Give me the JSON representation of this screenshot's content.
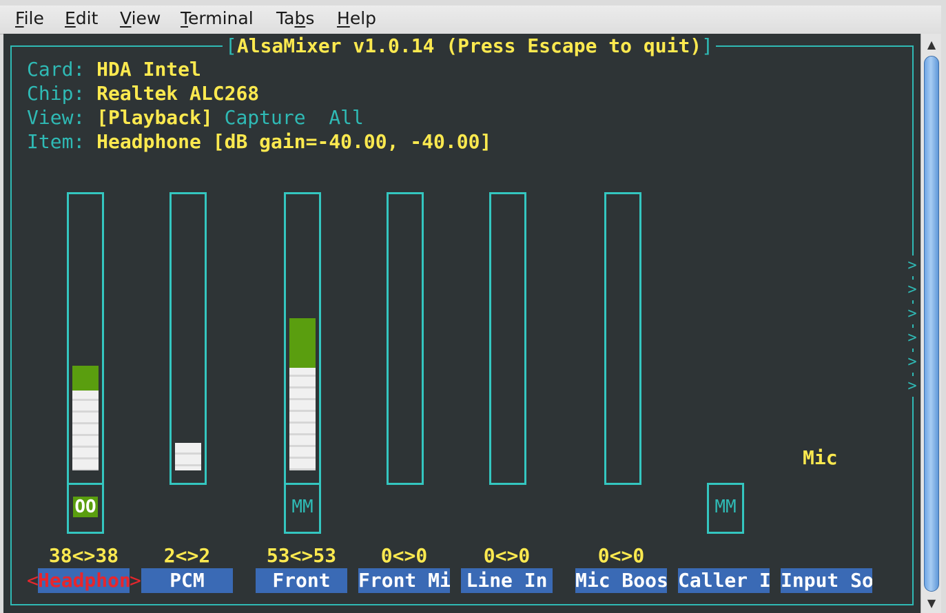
{
  "menu": [
    {
      "mnemonic": "F",
      "rest": "ile"
    },
    {
      "mnemonic": "E",
      "rest": "dit"
    },
    {
      "mnemonic": "V",
      "rest": "iew"
    },
    {
      "mnemonic": "T",
      "rest": "erminal"
    },
    {
      "pre": "Ta",
      "mnemonic": "b",
      "rest": "s"
    },
    {
      "mnemonic": "H",
      "rest": "elp"
    }
  ],
  "title": {
    "open": "[",
    "text": "AlsaMixer v1.0.14 (Press Escape to quit)",
    "close": "]"
  },
  "info": {
    "card_label": "Card:",
    "card": "HDA Intel",
    "chip_label": "Chip:",
    "chip": "Realtek ALC268",
    "view_label": "View:",
    "view_playback": "[Playback]",
    "view_capture": "Capture",
    "view_all": "All",
    "item_label": "Item:",
    "item": "Headphone [dB gain=-40.00, -40.00]"
  },
  "channels": [
    {
      "name": "Headphon",
      "volume": "38<>38",
      "level": 0.38,
      "green": 0.09,
      "mute": "OO",
      "mute_state": "on",
      "selected": true
    },
    {
      "name": "PCM",
      "volume": "2<>2",
      "level": 0.1,
      "green": 0,
      "mute": "",
      "mute_state": "none",
      "selected": false
    },
    {
      "name": "Front",
      "volume": "53<>53",
      "level": 0.55,
      "green": 0.18,
      "mute": "MM",
      "mute_state": "off",
      "selected": false
    },
    {
      "name": "Front Mi",
      "volume": "0<>0",
      "level": 0,
      "green": 0,
      "mute": "",
      "mute_state": "none",
      "selected": false
    },
    {
      "name": "Line In",
      "volume": "0<>0",
      "level": 0,
      "green": 0,
      "mute": "",
      "mute_state": "none",
      "selected": false
    },
    {
      "name": "Mic Boos",
      "volume": "0<>0",
      "level": 0,
      "green": 0,
      "mute": "",
      "mute_state": "none",
      "selected": false
    },
    {
      "name": "Caller I",
      "volume": "",
      "level": null,
      "green": 0,
      "mute": "MM",
      "mute_state": "off",
      "selected": false
    },
    {
      "name": "Input So",
      "volume": "",
      "level": null,
      "green": 0,
      "mute": "",
      "mute_state": "none",
      "selected": false
    }
  ],
  "selection_marks": {
    "left": "<",
    "right": ">"
  },
  "capture_source": "Mic",
  "scroll_arrows": [
    ">",
    ">",
    ">",
    ">",
    ">",
    ">"
  ],
  "scrollbar": {
    "up": "▲",
    "down": "▼"
  },
  "colors": {
    "background": "#2e3436",
    "frame": "#34c6c0",
    "text_yellow": "#fce94f",
    "label_cyan": "#2fbab5",
    "volume_green": "#5a9e0f",
    "name_bg": "#3a6ab5",
    "selected_red": "#e8262c"
  }
}
